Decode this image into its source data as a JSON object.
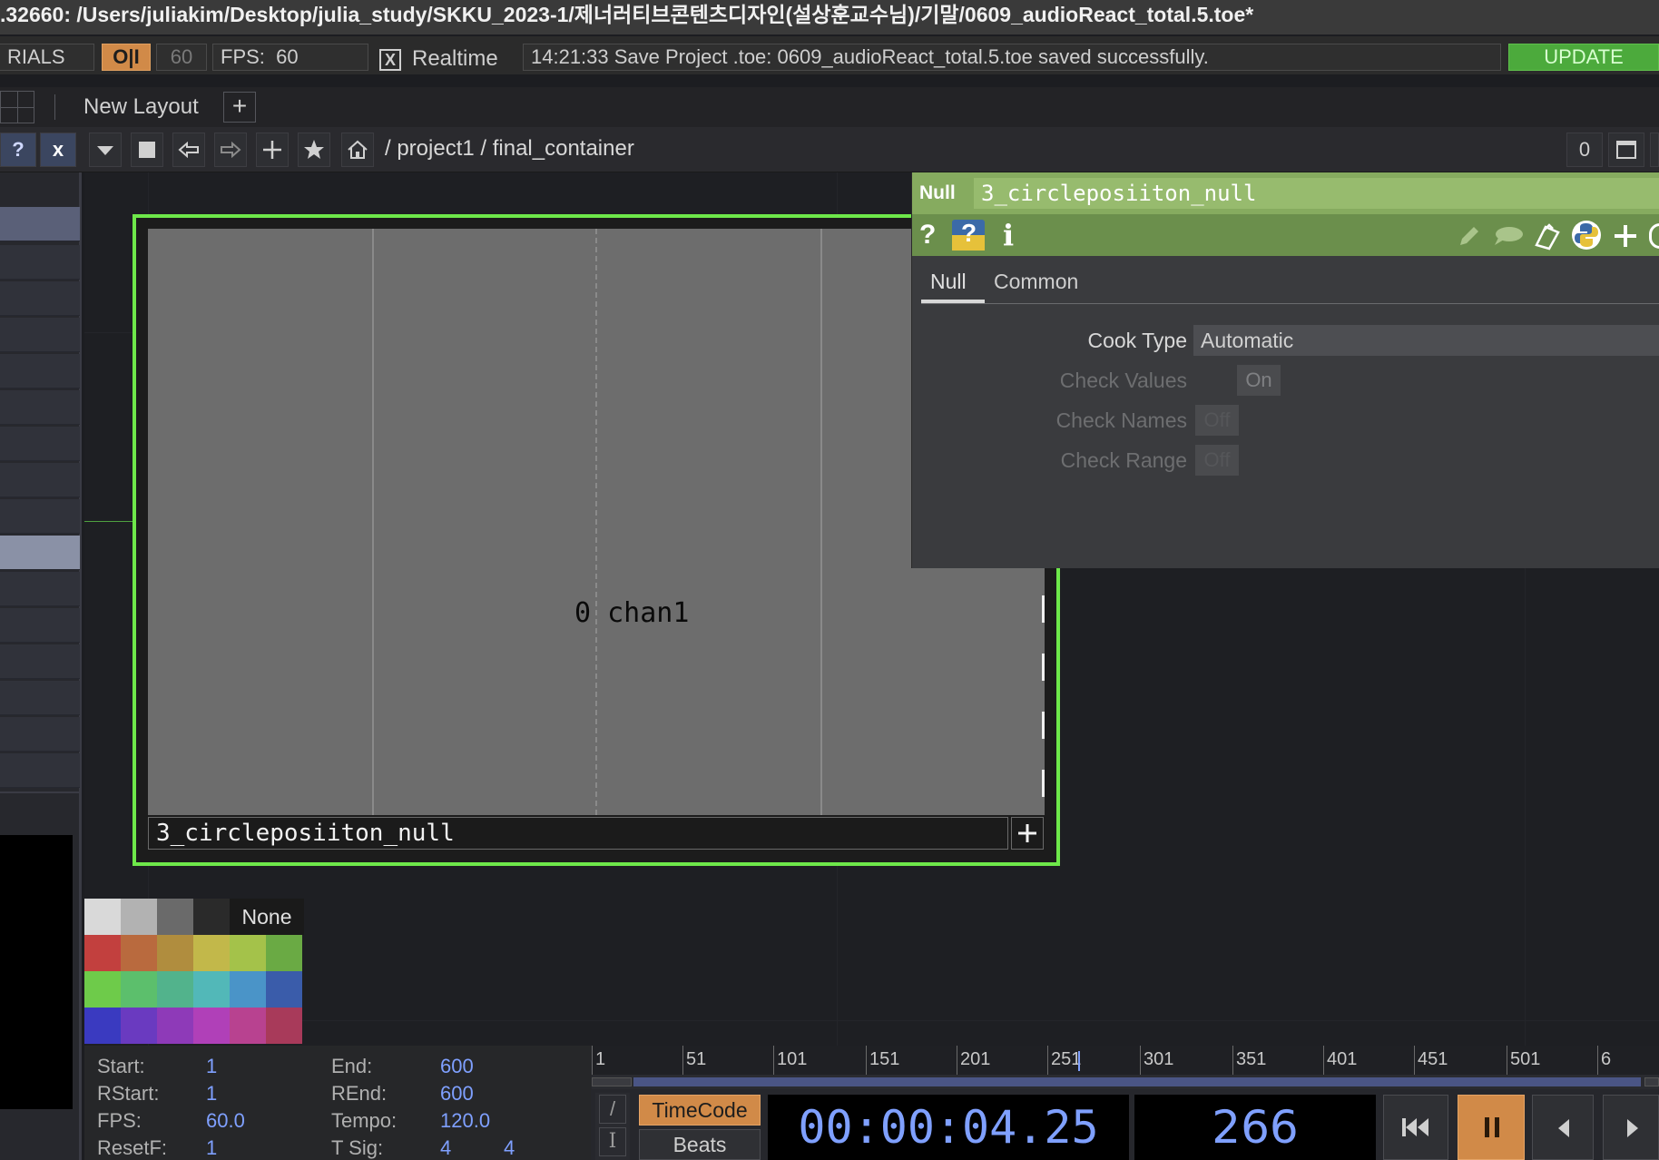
{
  "window": {
    "title": ".32660: /Users/juliakim/Desktop/julia_study/SKKU_2023-1/제너러티브콘텐츠디자인(설상훈교수님)/기말/0609_audioReact_total.5.toe*"
  },
  "toolbar": {
    "tutorials_label": "RIALS",
    "oi_label": "O|I",
    "fps_box": "60",
    "fps_label": "FPS:",
    "fps_value": "60",
    "realtime_check": "X",
    "realtime_label": "Realtime",
    "status_message": "14:21:33 Save Project .toe: 0609_audioReact_total.5.toe saved successfully.",
    "update_label": "UPDATE"
  },
  "layout": {
    "new_layout_label": "New Layout",
    "add_label": "+"
  },
  "nav": {
    "help_label": "?",
    "close_label": "x",
    "path": "/ project1 / final_container",
    "counter": "0"
  },
  "operator": {
    "channel_value": "0",
    "channel_name": "chan1",
    "name": "3_circleposiiton_null",
    "plus_label": "+"
  },
  "param": {
    "type_label": "Null",
    "op_name": "3_circleposiiton_null",
    "tabs": [
      {
        "label": "Null"
      },
      {
        "label": "Common"
      }
    ],
    "cook_type_label": "Cook Type",
    "cook_type_value": "Automatic",
    "check_values_label": "Check Values",
    "check_values_value": "On",
    "check_names_label": "Check Names",
    "check_names_value": "Off",
    "check_range_label": "Check Range",
    "check_range_value": "Off"
  },
  "colors": {
    "none_label": "None",
    "outline": "#6ee84a",
    "accent_orange": "#d18a48"
  },
  "timeline": {
    "start_label": "Start:",
    "start_value": "1",
    "rstart_label": "RStart:",
    "rstart_value": "1",
    "fps_label": "FPS:",
    "fps_value": "60.0",
    "resetf_label": "ResetF:",
    "resetf_value": "1",
    "end_label": "End:",
    "end_value": "600",
    "rend_label": "REnd:",
    "rend_value": "600",
    "tempo_label": "Tempo:",
    "tempo_value": "120.0",
    "tsig_label": "T Sig:",
    "tsig_value_a": "4",
    "tsig_value_b": "4",
    "ticks": [
      "1",
      "51",
      "101",
      "151",
      "201",
      "251",
      "301",
      "351",
      "401",
      "451",
      "501",
      "6"
    ],
    "timecode_label": "TimeCode",
    "beats_label": "Beats",
    "slash_label": "/",
    "cursor_label": "I",
    "timecode_value": "00:00:04.25",
    "frame_value": "266"
  }
}
